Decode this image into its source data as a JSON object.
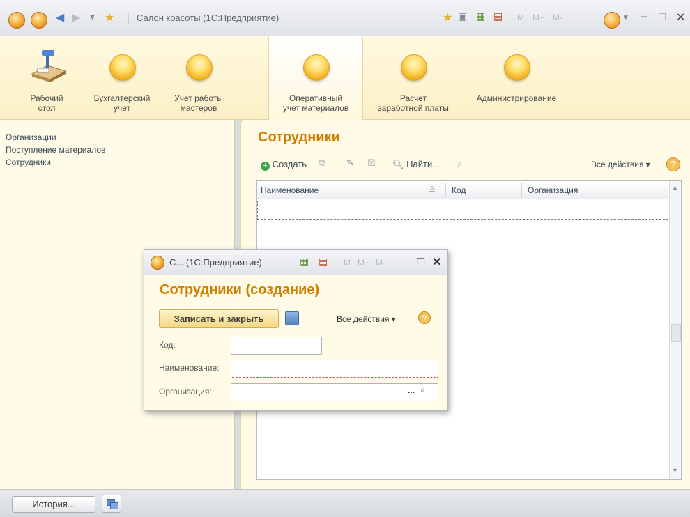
{
  "titlebar": {
    "title": "Салон красоты  (1С:Предприятие)",
    "m_buttons": [
      "M",
      "M+",
      "M-"
    ]
  },
  "sections": [
    {
      "label": "Рабочий\nстол"
    },
    {
      "label": "Бухгалтерский\nучет"
    },
    {
      "label": "Учет работы\nмастеров"
    },
    {
      "label": "Оперативный\nучет материалов"
    },
    {
      "label": "Расчет\nзаработной платы"
    },
    {
      "label": "Администрирование"
    }
  ],
  "nav": {
    "items": [
      "Организации",
      "Поступление материалов",
      "Сотрудники"
    ]
  },
  "list": {
    "title": "Сотрудники",
    "create_label": "Создать",
    "find_label": "Найти...",
    "all_actions": "Все действия ▾",
    "columns": [
      "Наименование",
      "Код",
      "Организация"
    ]
  },
  "dialog": {
    "window_title": "С...  (1С:Предприятие)",
    "m_buttons": [
      "M",
      "M+",
      "M-"
    ],
    "heading": "Сотрудники (создание)",
    "save_close": "Записать и закрыть",
    "all_actions": "Все действия ▾",
    "fields": {
      "code_label": "Код:",
      "code_value": "",
      "name_label": "Наименование:",
      "name_value": "",
      "org_label": "Организация:",
      "org_value": ""
    },
    "select_glyph": "..."
  },
  "bottombar": {
    "history_label": "История..."
  },
  "colors": {
    "accent_title": "#d07e00",
    "panel_bg": "#fffbe6"
  }
}
